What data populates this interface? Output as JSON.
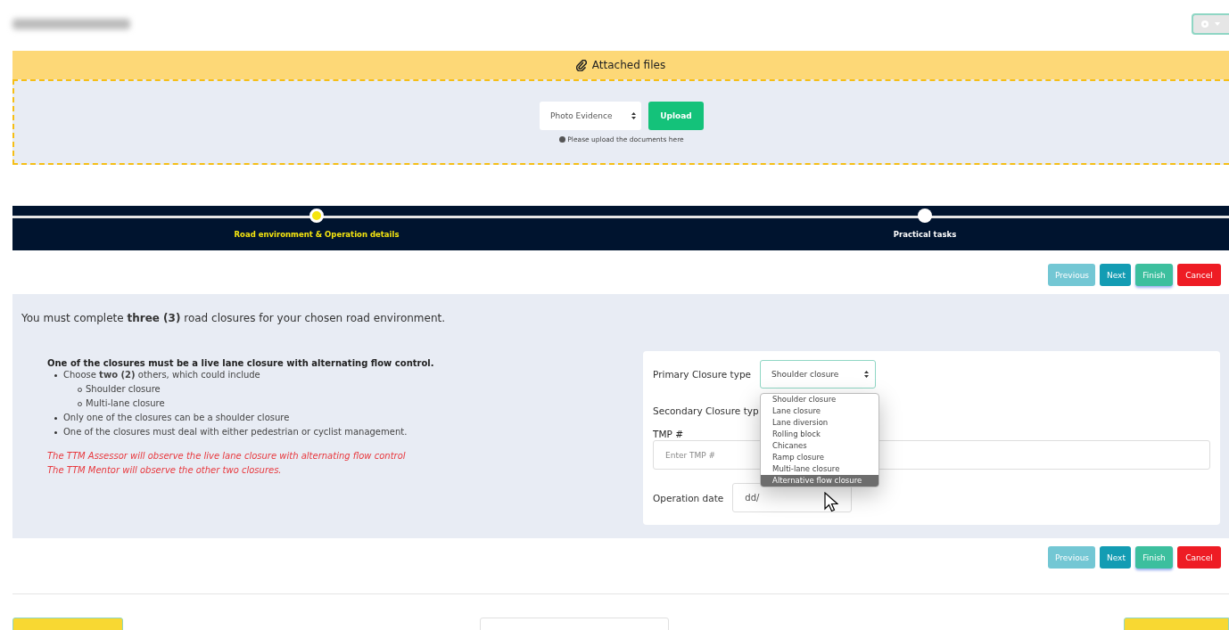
{
  "attachments": {
    "title": "Attached files",
    "document_type": "Photo Evidence",
    "upload_button": "Upload",
    "hint": "Please upload the documents here"
  },
  "steps": [
    {
      "label": "Road environment & Operation details",
      "selected": true
    },
    {
      "label": "Practical tasks",
      "selected": false
    }
  ],
  "buttons_top": [
    {
      "label": "Previous",
      "kind": "previous",
      "disabled": true
    },
    {
      "label": "Next",
      "kind": "next",
      "disabled": false
    },
    {
      "label": "Finish",
      "kind": "finish",
      "disabled": false
    },
    {
      "label": "Cancel",
      "kind": "cancel",
      "disabled": false
    }
  ],
  "instructions": {
    "intro": "You must complete **three (3)** road closures for your chosen road environment.",
    "heading": "One of the closures must be a live lane closure with alternating flow control.",
    "bullets": [
      {
        "text": "Choose **two (2)** others, which could include",
        "children": [
          {
            "text": "Shoulder closure"
          },
          {
            "text": "Multi-lane closure"
          }
        ]
      },
      {
        "text": "Only one of the closures can be a shoulder closure"
      },
      {
        "text": "One of the closures must deal with either pedestrian or cyclist management."
      }
    ],
    "notes": [
      "The TTM Assessor will observe the live lane closure with alternating flow control",
      "The TTM Mentor will observe the other two closures."
    ]
  },
  "form": {
    "primary_label": "Primary Closure type",
    "primary_value": "Shoulder closure",
    "secondary_label": "Secondary Closure typ",
    "tmp_label": "TMP #",
    "tmp_placeholder": "Enter TMP #",
    "date_label": "Operation date",
    "date_value": "dd/",
    "options": [
      {
        "label": "Shoulder closure",
        "selected": false
      },
      {
        "label": "Lane closure",
        "selected": false
      },
      {
        "label": "Lane diversion",
        "selected": false
      },
      {
        "label": "Rolling block",
        "selected": false
      },
      {
        "label": "Chicanes",
        "selected": false
      },
      {
        "label": "Ramp closure",
        "selected": false
      },
      {
        "label": "Multi-lane closure",
        "selected": false
      },
      {
        "label": "Alternative flow closure",
        "selected": true
      }
    ]
  },
  "buttons_bottom": [
    {
      "label": "Previous",
      "kind": "previous",
      "disabled": true
    },
    {
      "label": "Next",
      "kind": "next",
      "disabled": false
    },
    {
      "label": "Finish",
      "kind": "finish",
      "disabled": false
    },
    {
      "label": "Cancel",
      "kind": "cancel",
      "disabled": false
    }
  ]
}
